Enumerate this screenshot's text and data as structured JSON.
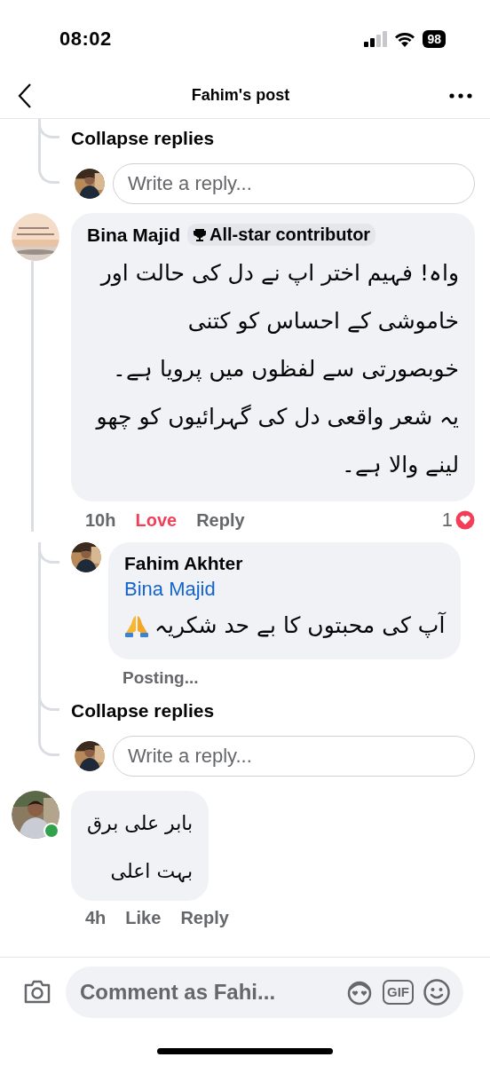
{
  "status_bar": {
    "time": "08:02",
    "battery": "98"
  },
  "header": {
    "title": "Fahim's post"
  },
  "thread_top": {
    "collapse_label": "Collapse replies",
    "reply_placeholder": "Write a reply..."
  },
  "comments": [
    {
      "kind": "thread",
      "author": "Bina Majid",
      "badge": "All-star contributor",
      "text": "واہ! فہیم اختر اپ نے دل کی حالت اور خاموشی کے احساس کو کتنی خوبصورتی سے لفظوں میں پرویا ہے۔ یہ شعر واقعی دل کی گہرائیوں کو چھو لینے والا ہے۔",
      "time": "10h",
      "reaction": "Love",
      "reacted": true,
      "reply_label": "Reply",
      "reaction_count": "1",
      "replies": [
        {
          "author": "Fahim Akhter",
          "mention": "Bina Majid",
          "text": "آپ کی محبتوں کا بے حد شکریہ",
          "status": "Posting..."
        }
      ],
      "collapse_label": "Collapse replies",
      "reply_placeholder": "Write a reply..."
    },
    {
      "kind": "plain",
      "lines": [
        "بابر علی برق",
        "بہت اعلی"
      ],
      "time": "4h",
      "reaction": "Like",
      "reacted": false,
      "reply_label": "Reply",
      "online": true
    }
  ],
  "composer": {
    "placeholder": "Comment as Fahi...",
    "gif_label": "GIF"
  }
}
